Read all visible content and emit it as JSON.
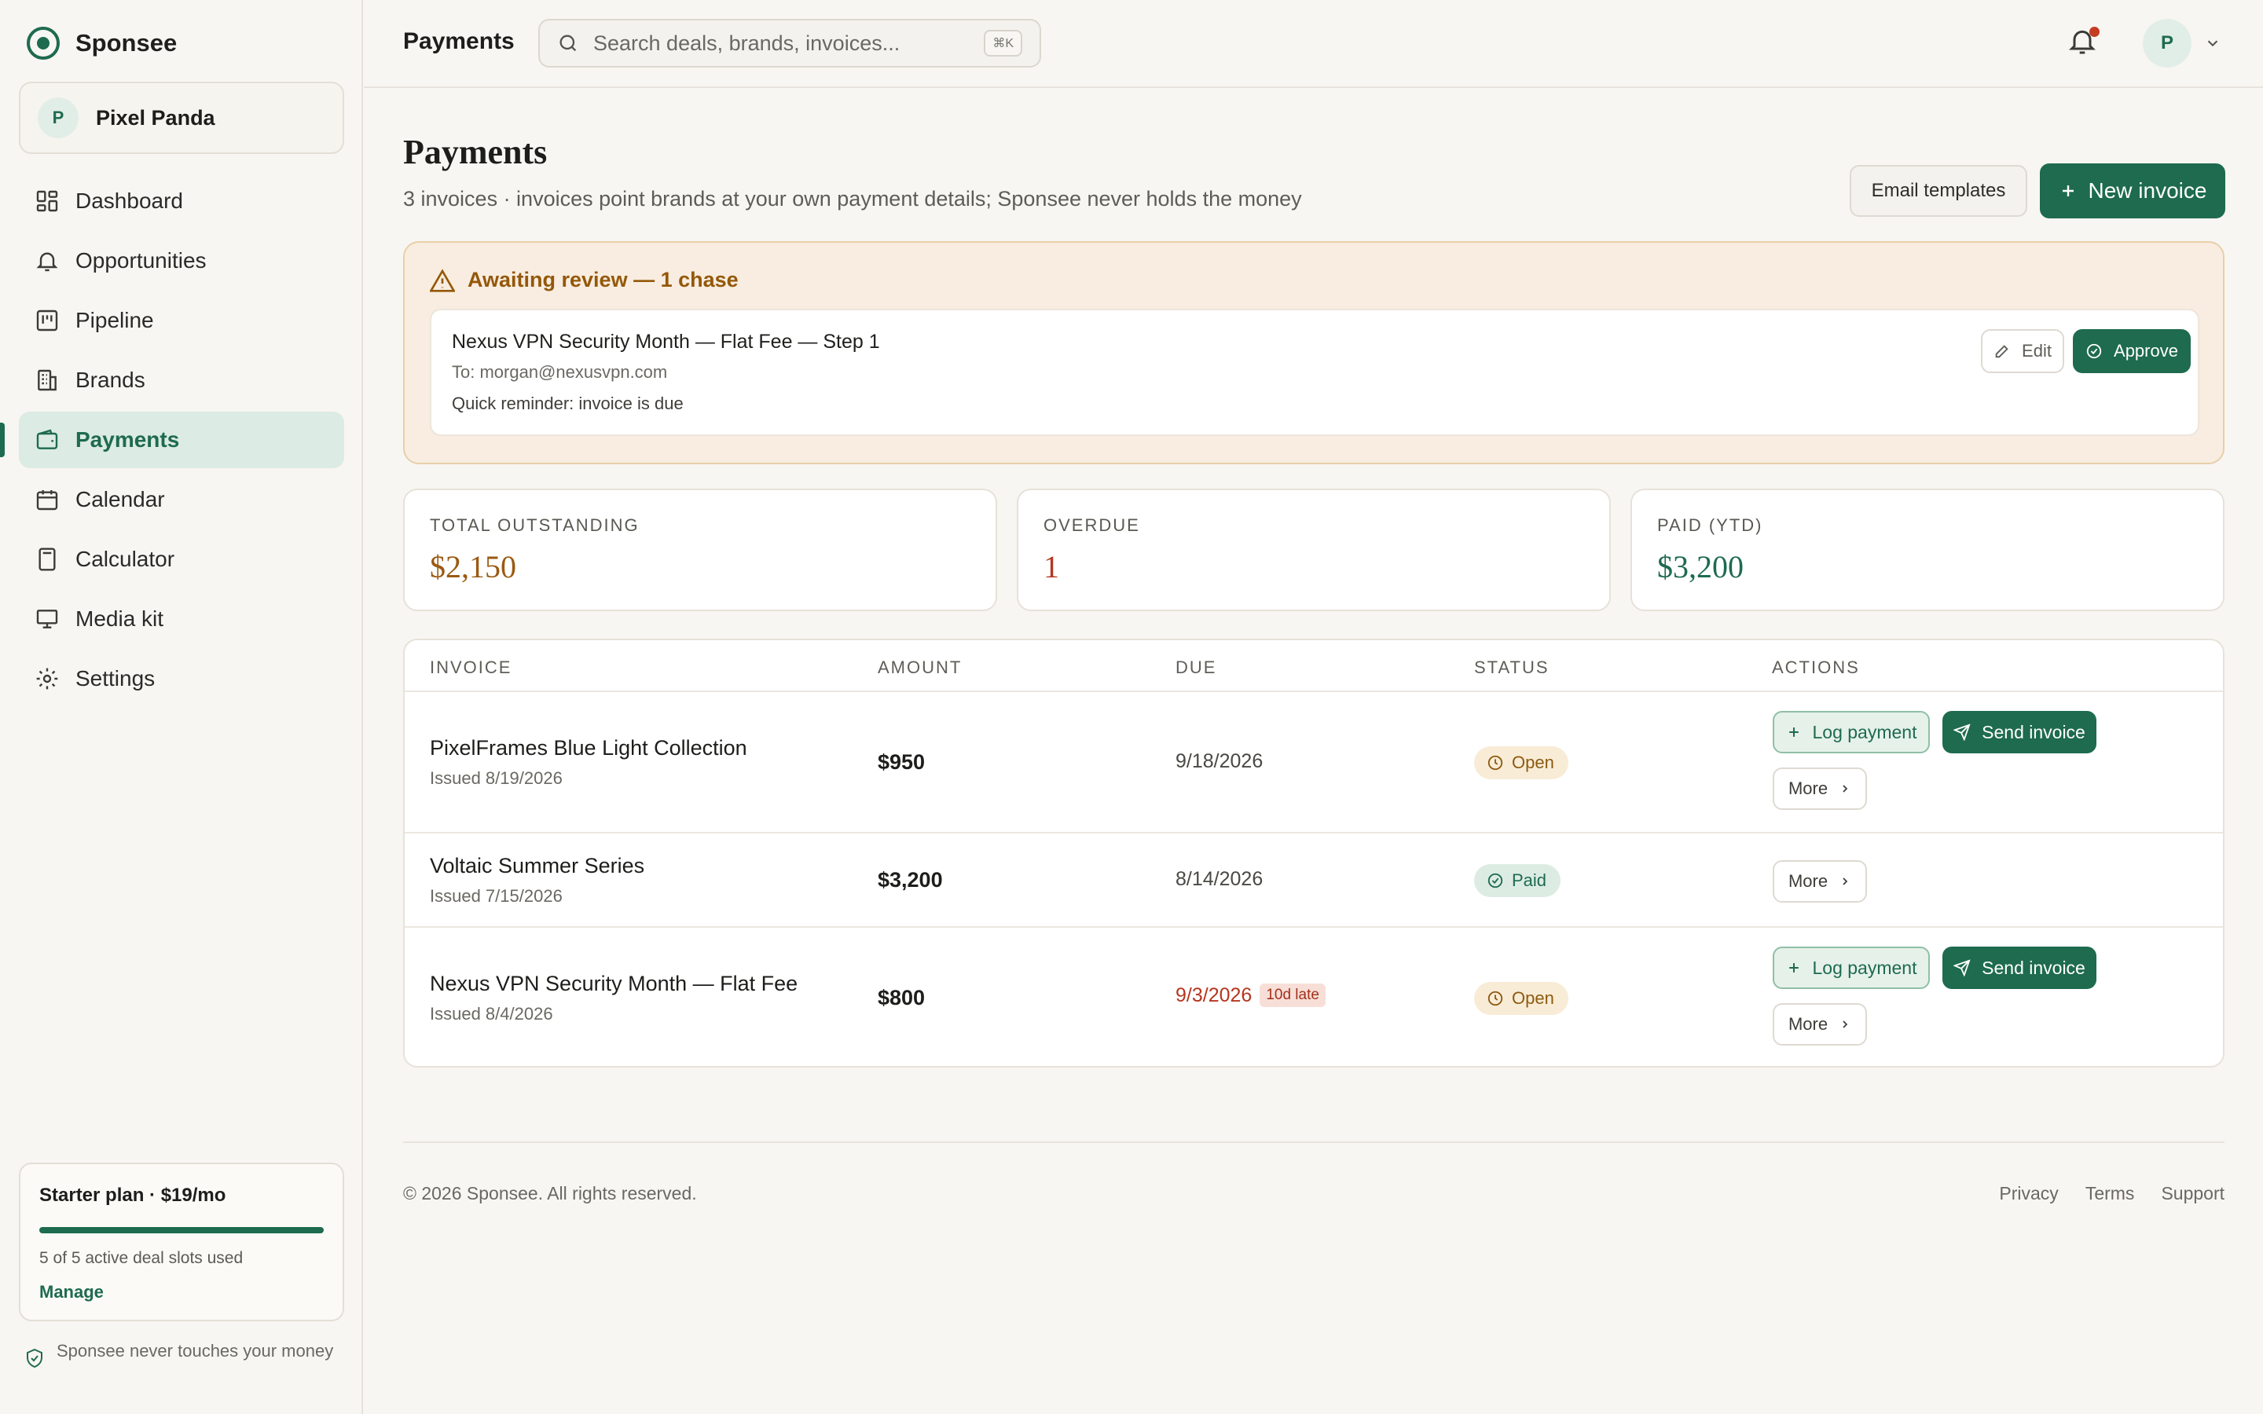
{
  "app": {
    "name": "Sponsee"
  },
  "workspace": {
    "initial": "P",
    "name": "Pixel Panda"
  },
  "sidebar": {
    "items": [
      {
        "label": "Dashboard",
        "icon": "dashboard-icon"
      },
      {
        "label": "Opportunities",
        "icon": "bell-icon"
      },
      {
        "label": "Pipeline",
        "icon": "pipeline-icon"
      },
      {
        "label": "Brands",
        "icon": "building-icon"
      },
      {
        "label": "Payments",
        "icon": "wallet-icon",
        "active": true
      },
      {
        "label": "Calendar",
        "icon": "calendar-icon"
      },
      {
        "label": "Calculator",
        "icon": "calculator-icon"
      },
      {
        "label": "Media kit",
        "icon": "presentation-icon"
      },
      {
        "label": "Settings",
        "icon": "gear-icon"
      }
    ],
    "plan": {
      "title": "Starter plan · $19/mo",
      "usage_fraction": 1.0,
      "usage_text": "5 of 5 active deal slots used",
      "manage_label": "Manage"
    },
    "trust_note": "Sponsee never touches your money"
  },
  "header": {
    "title": "Payments",
    "search_placeholder": "Search deals, brands, invoices...",
    "search_shortcut": "⌘K",
    "notifications_unread": true,
    "user_initial": "P"
  },
  "page": {
    "title": "Payments",
    "subtitle": "3 invoices · invoices point brands at your own payment details; Sponsee never holds the money",
    "email_templates_label": "Email templates",
    "new_invoice_label": "New invoice"
  },
  "review": {
    "heading": "Awaiting review — 1 chase",
    "item": {
      "title": "Nexus VPN Security Month — Flat Fee — Step 1",
      "to": "To: morgan@nexusvpn.com",
      "message": "Quick reminder: invoice is due",
      "edit_label": "Edit",
      "approve_label": "Approve"
    }
  },
  "stats": [
    {
      "label": "Total outstanding",
      "value": "$2,150",
      "color": "#9a5a12"
    },
    {
      "label": "Overdue",
      "value": "1",
      "color": "#b5361f"
    },
    {
      "label": "Paid (YTD)",
      "value": "$3,200",
      "color": "#1e6b4f"
    }
  ],
  "table": {
    "columns": [
      "INVOICE",
      "AMOUNT",
      "DUE",
      "STATUS",
      "ACTIONS"
    ],
    "rows": [
      {
        "name": "PixelFrames Blue Light Collection",
        "issued": "Issued 8/19/2026",
        "amount": "$950",
        "due": "9/18/2026",
        "late_label": "",
        "status": "Open",
        "actions": {
          "log": "Log payment",
          "send": "Send invoice",
          "more": "More"
        }
      },
      {
        "name": "Voltaic Summer Series",
        "issued": "Issued 7/15/2026",
        "amount": "$3,200",
        "due": "8/14/2026",
        "late_label": "",
        "status": "Paid",
        "actions": {
          "more": "More"
        }
      },
      {
        "name": "Nexus VPN Security Month — Flat Fee",
        "issued": "Issued 8/4/2026",
        "amount": "$800",
        "due": "9/3/2026",
        "late_label": "10d late",
        "status": "Open",
        "actions": {
          "log": "Log payment",
          "send": "Send invoice",
          "more": "More"
        }
      }
    ]
  },
  "footer": {
    "copyright": "© 2026 Sponsee. All rights reserved.",
    "links": [
      "Privacy",
      "Terms",
      "Support"
    ]
  },
  "colors": {
    "brand": "#1e6b4f",
    "warning": "#94580a",
    "danger": "#b5361f",
    "background": "#f8f6f2"
  }
}
